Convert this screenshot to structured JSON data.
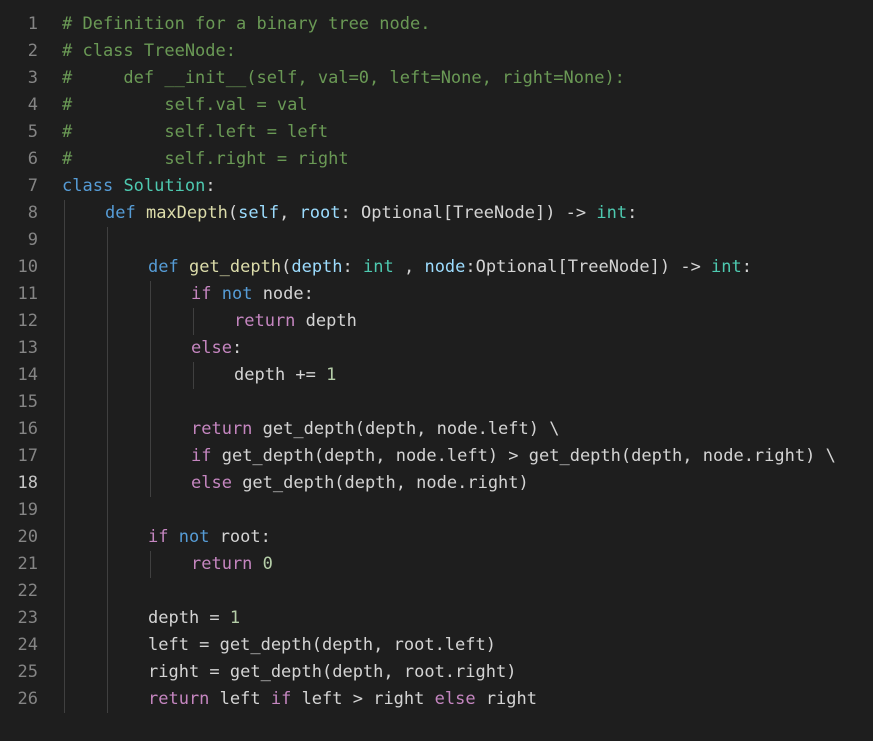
{
  "colors": {
    "background": "#1e1e1e",
    "line_number": "#858585",
    "current_line_number": "#c6c6c6",
    "comment": "#6a9955",
    "keyword": "#569cd6",
    "control": "#c586c0",
    "class": "#4ec9b0",
    "function": "#dcdcaa",
    "param": "#9cdcfe",
    "number": "#b5cea8",
    "text": "#d4d4d4"
  },
  "editor": {
    "current_line": 18,
    "lines": [
      {
        "n": "1",
        "indent": 0,
        "guides": 0,
        "tokens": [
          {
            "t": "comment",
            "v": "# Definition for a binary tree node."
          }
        ]
      },
      {
        "n": "2",
        "indent": 0,
        "guides": 0,
        "tokens": [
          {
            "t": "comment",
            "v": "# class TreeNode:"
          }
        ]
      },
      {
        "n": "3",
        "indent": 0,
        "guides": 0,
        "tokens": [
          {
            "t": "comment",
            "v": "#     def __init__(self, val=0, left=None, right=None):"
          }
        ]
      },
      {
        "n": "4",
        "indent": 0,
        "guides": 0,
        "tokens": [
          {
            "t": "comment",
            "v": "#         self.val = val"
          }
        ]
      },
      {
        "n": "5",
        "indent": 0,
        "guides": 0,
        "tokens": [
          {
            "t": "comment",
            "v": "#         self.left = left"
          }
        ]
      },
      {
        "n": "6",
        "indent": 0,
        "guides": 0,
        "tokens": [
          {
            "t": "comment",
            "v": "#         self.right = right"
          }
        ]
      },
      {
        "n": "7",
        "indent": 0,
        "guides": 0,
        "tokens": [
          {
            "t": "keyword",
            "v": "class"
          },
          {
            "t": "text",
            "v": " "
          },
          {
            "t": "class",
            "v": "Solution"
          },
          {
            "t": "text",
            "v": ":"
          }
        ]
      },
      {
        "n": "8",
        "indent": 1,
        "guides": 1,
        "tokens": [
          {
            "t": "keyword",
            "v": "def"
          },
          {
            "t": "text",
            "v": " "
          },
          {
            "t": "func",
            "v": "maxDepth"
          },
          {
            "t": "text",
            "v": "("
          },
          {
            "t": "param",
            "v": "self"
          },
          {
            "t": "text",
            "v": ", "
          },
          {
            "t": "param",
            "v": "root"
          },
          {
            "t": "text",
            "v": ": Optional[TreeNode]) -> "
          },
          {
            "t": "class",
            "v": "int"
          },
          {
            "t": "text",
            "v": ":"
          }
        ]
      },
      {
        "n": "9",
        "indent": 0,
        "guides": 2,
        "tokens": []
      },
      {
        "n": "10",
        "indent": 2,
        "guides": 2,
        "tokens": [
          {
            "t": "keyword",
            "v": "def"
          },
          {
            "t": "text",
            "v": " "
          },
          {
            "t": "func",
            "v": "get_depth"
          },
          {
            "t": "text",
            "v": "("
          },
          {
            "t": "param",
            "v": "depth"
          },
          {
            "t": "text",
            "v": ": "
          },
          {
            "t": "class",
            "v": "int"
          },
          {
            "t": "text",
            "v": " , "
          },
          {
            "t": "param",
            "v": "node"
          },
          {
            "t": "text",
            "v": ":Optional[TreeNode]) -> "
          },
          {
            "t": "class",
            "v": "int"
          },
          {
            "t": "text",
            "v": ":"
          }
        ]
      },
      {
        "n": "11",
        "indent": 3,
        "guides": 3,
        "tokens": [
          {
            "t": "control",
            "v": "if"
          },
          {
            "t": "text",
            "v": " "
          },
          {
            "t": "keyword",
            "v": "not"
          },
          {
            "t": "text",
            "v": " node:"
          }
        ]
      },
      {
        "n": "12",
        "indent": 4,
        "guides": 4,
        "tokens": [
          {
            "t": "control",
            "v": "return"
          },
          {
            "t": "text",
            "v": " depth"
          }
        ]
      },
      {
        "n": "13",
        "indent": 3,
        "guides": 3,
        "tokens": [
          {
            "t": "control",
            "v": "else"
          },
          {
            "t": "text",
            "v": ":"
          }
        ]
      },
      {
        "n": "14",
        "indent": 4,
        "guides": 4,
        "tokens": [
          {
            "t": "text",
            "v": "depth += "
          },
          {
            "t": "number",
            "v": "1"
          }
        ]
      },
      {
        "n": "15",
        "indent": 0,
        "guides": 3,
        "tokens": []
      },
      {
        "n": "16",
        "indent": 3,
        "guides": 3,
        "tokens": [
          {
            "t": "control",
            "v": "return"
          },
          {
            "t": "text",
            "v": " get_depth(depth, node.left) \\"
          }
        ]
      },
      {
        "n": "17",
        "indent": 3,
        "guides": 3,
        "tokens": [
          {
            "t": "control",
            "v": "if"
          },
          {
            "t": "text",
            "v": " get_depth(depth, node.left) > get_depth(depth, node.right) \\"
          }
        ]
      },
      {
        "n": "18",
        "indent": 3,
        "guides": 3,
        "tokens": [
          {
            "t": "control",
            "v": "else"
          },
          {
            "t": "text",
            "v": " get_depth(depth, node.right)"
          }
        ]
      },
      {
        "n": "19",
        "indent": 0,
        "guides": 2,
        "tokens": []
      },
      {
        "n": "20",
        "indent": 2,
        "guides": 2,
        "tokens": [
          {
            "t": "control",
            "v": "if"
          },
          {
            "t": "text",
            "v": " "
          },
          {
            "t": "keyword",
            "v": "not"
          },
          {
            "t": "text",
            "v": " root:"
          }
        ]
      },
      {
        "n": "21",
        "indent": 3,
        "guides": 3,
        "tokens": [
          {
            "t": "control",
            "v": "return"
          },
          {
            "t": "text",
            "v": " "
          },
          {
            "t": "number",
            "v": "0"
          }
        ]
      },
      {
        "n": "22",
        "indent": 0,
        "guides": 2,
        "tokens": []
      },
      {
        "n": "23",
        "indent": 2,
        "guides": 2,
        "tokens": [
          {
            "t": "text",
            "v": "depth = "
          },
          {
            "t": "number",
            "v": "1"
          }
        ]
      },
      {
        "n": "24",
        "indent": 2,
        "guides": 2,
        "tokens": [
          {
            "t": "text",
            "v": "left = get_depth(depth, root.left)"
          }
        ]
      },
      {
        "n": "25",
        "indent": 2,
        "guides": 2,
        "tokens": [
          {
            "t": "text",
            "v": "right = get_depth(depth, root.right)"
          }
        ]
      },
      {
        "n": "26",
        "indent": 2,
        "guides": 2,
        "tokens": [
          {
            "t": "control",
            "v": "return"
          },
          {
            "t": "text",
            "v": " left "
          },
          {
            "t": "control",
            "v": "if"
          },
          {
            "t": "text",
            "v": " left > right "
          },
          {
            "t": "control",
            "v": "else"
          },
          {
            "t": "text",
            "v": " right"
          }
        ]
      }
    ]
  }
}
